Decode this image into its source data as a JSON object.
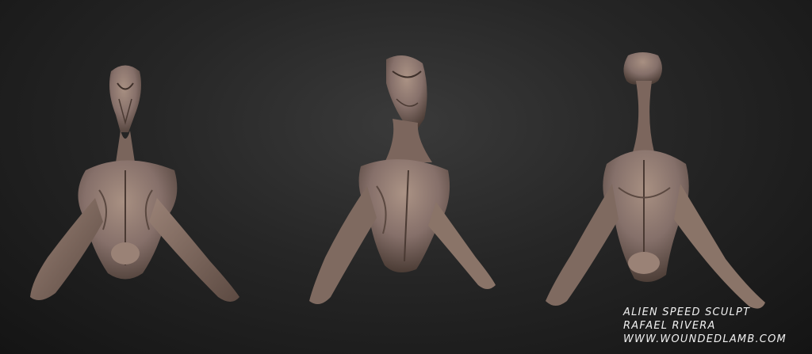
{
  "caption": {
    "line1": "ALIEN SPEED SCULPT",
    "line2": "RAFAEL RIVERA",
    "line3": "WWW.WOUNDEDLAMB.COM"
  },
  "colors": {
    "background": "#1e1e1e",
    "clay": "#8a7468",
    "clay_light": "#a89082",
    "clay_dark": "#4e3f38",
    "caption": "#f0f0f0"
  }
}
